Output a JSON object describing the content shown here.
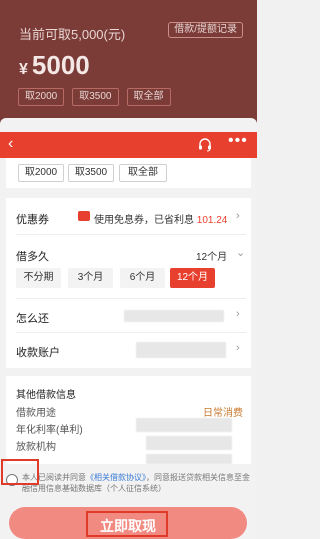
{
  "background_view": {
    "title": "当前可取5,000(元)",
    "records_link": "借款/提额记录",
    "amount_symbol": "¥",
    "amount": "5000",
    "chips": [
      "取2000",
      "取3500",
      "取全部"
    ]
  },
  "sheet": {
    "chips": [
      "取2000",
      "取3500",
      "取全部"
    ],
    "coupon": {
      "label": "优惠券",
      "text": "使用免息券，已省利息",
      "saved": "101.24"
    },
    "term": {
      "label": "借多久",
      "selected_value": "12个月",
      "options": [
        "不分期",
        "3个月",
        "6个月",
        "12个月"
      ]
    },
    "repay": {
      "label": "怎么还"
    },
    "account": {
      "label": "收款账户"
    },
    "other": {
      "title": "其他借款信息",
      "purpose_label": "借款用途",
      "purpose_value": "日常消费",
      "rate_label": "年化利率(单利)",
      "lender_label": "放款机构"
    },
    "agreement": {
      "prefix": "本人已阅读并同意",
      "link": "《相关借款协议》",
      "suffix": "，同意报送贷款相关信息至金融信用信息基础数据库（个人征信系统）"
    },
    "cta": "立即取现"
  },
  "colors": {
    "accent": "#e8402e",
    "cta_bg": "#f18a81",
    "highlight_box": "#e03a2b"
  }
}
